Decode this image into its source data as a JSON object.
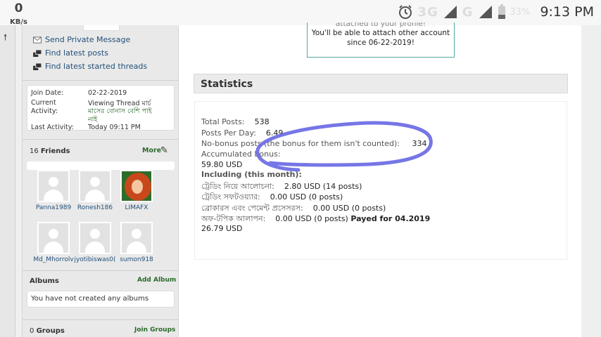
{
  "status_bar": {
    "speed_value": "0",
    "speed_unit": "KB/s",
    "network": "3G",
    "network_g": "G",
    "battery": "33%",
    "time": "9:13 PM",
    "icons": [
      "alarm-icon",
      "signal-icon",
      "battery-icon"
    ]
  },
  "sidebar": {
    "links": [
      {
        "label": "Send Private Message",
        "icon": "envelope-icon"
      },
      {
        "label": "Find latest posts",
        "icon": "posts-icon"
      },
      {
        "label": "Find latest started threads",
        "icon": "threads-icon"
      }
    ],
    "info": {
      "join_date_label": "Join Date:",
      "join_date": "02-22-2019",
      "current_activity_label": "Current Activity:",
      "current_label_line1": "Current",
      "current_label_line2": "Activity:",
      "current_activity_line1": "Viewing Thread মার্চ",
      "current_activity_line2": "মাসের বোনাস বেশি পাই",
      "current_activity_line3": "নাই",
      "last_activity_label": "Last Activity:",
      "last_activity": "Today 09:11 PM"
    },
    "friends": {
      "count": "16",
      "label": "Friends",
      "more_label": "More",
      "items": [
        {
          "name": "Panna1989"
        },
        {
          "name": "Ronesh186"
        },
        {
          "name": "LIMAFX"
        },
        {
          "name": "Md_Mhorrolv"
        },
        {
          "name": "jyotibiswas0("
        },
        {
          "name": "sumon918"
        }
      ]
    },
    "albums": {
      "label": "Albums",
      "add_label": "Add Album",
      "empty_text": "You have not created any albums"
    },
    "groups": {
      "count": "0",
      "label": "Groups",
      "join_label": "Join Groups"
    }
  },
  "main": {
    "notice": {
      "line0": "attached to your profile!",
      "line1": "You'll be able to attach other account",
      "line2": "since 06-22-2019!"
    },
    "statistics": {
      "title": "Statistics",
      "total_posts_label": "Total Posts:",
      "total_posts": "538",
      "posts_per_day_label": "Posts Per Day:",
      "posts_per_day": "6.49",
      "nobonus_label": "No-bonus posts (the bonus for them isn't counted):",
      "nobonus": "334",
      "accum_label": "Accumulated bonus:",
      "accum_value": "59.80 USD",
      "including_label": "Including (this month):",
      "cat1_label": "ট্রেডিং নিয়ে আলোচনা:",
      "cat1_value": "2.80 USD (14 posts)",
      "cat2_label": "ট্রেডিং সফটওয়্যার:",
      "cat2_value": "0.00 USD (0 posts)",
      "cat3_label": "ব্রোকারস এবং পেমেন্ট প্রসেসরস:",
      "cat3_value": "0.00 USD (0 posts)",
      "cat4_label": "অফ-টপিক আলাপন:",
      "cat4_value": "0.00 USD (0 posts)",
      "payed_label": "Payed for 04.2019",
      "payed_value": "26.79 USD"
    }
  },
  "colors": {
    "link": "#22507a",
    "green_link": "#2a6a2a",
    "scribble": "#6f6fe6",
    "notice_border": "#57a5a0"
  }
}
